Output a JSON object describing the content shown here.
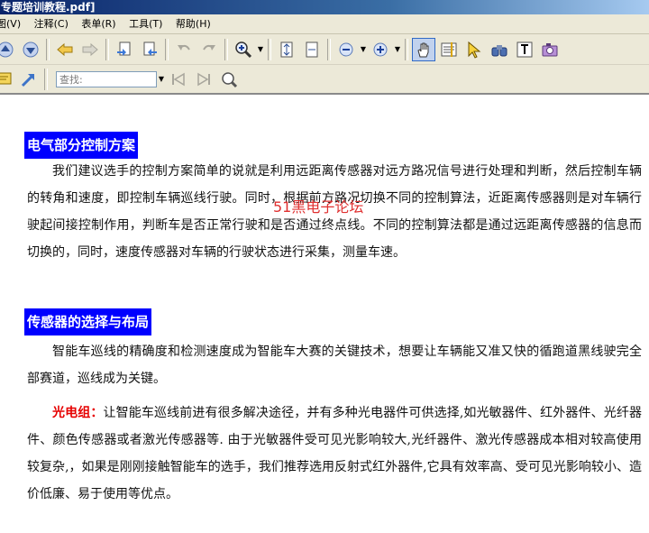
{
  "window": {
    "title": "专题培训教程.pdf]"
  },
  "menu": {
    "items": [
      "图(V)",
      "注释(C)",
      "表单(R)",
      "工具(T)",
      "帮助(H)"
    ]
  },
  "search": {
    "placeholder": "查找:"
  },
  "document": {
    "section1": {
      "heading": "电气部分控制方案",
      "body": "我们建议选手的控制方案简单的说就是利用远距离传感器对远方路况信号进行处理和判断，然后控制车辆的转角和速度，即控制车辆巡线行驶。同时，根据前方路况切换不同的控制算法，近距离传感器则是对车辆行驶起间接控制作用，判断车是否正常行驶和是否通过终点线。不同的控制算法都是通过远距离传感器的信息而切换的，同时，速度传感器对车辆的行驶状态进行采集，测量车速。"
    },
    "watermark": "51黑电子论坛",
    "section2": {
      "heading": "传感器的选择与布局",
      "body1": "智能车巡线的精确度和检测速度成为智能车大赛的关键技术，想要让车辆能又准又快的循跑道黑线驶完全部赛道，巡线成为关键。",
      "lead": "光电组：",
      "body2": "让智能车巡线前进有很多解决途径，并有多种光电器件可供选择,如光敏器件、红外器件、光纤器件、颜色传感器或者激光传感器等. 由于光敏器件受可见光影响较大,光纤器件、激光传感器成本相对较高使用较复杂,，如果是刚刚接触智能车的选手，我们推荐选用反射式红外器件,它具有效率高、受可见光影响较小、造价低廉、易于使用等优点。"
    }
  }
}
